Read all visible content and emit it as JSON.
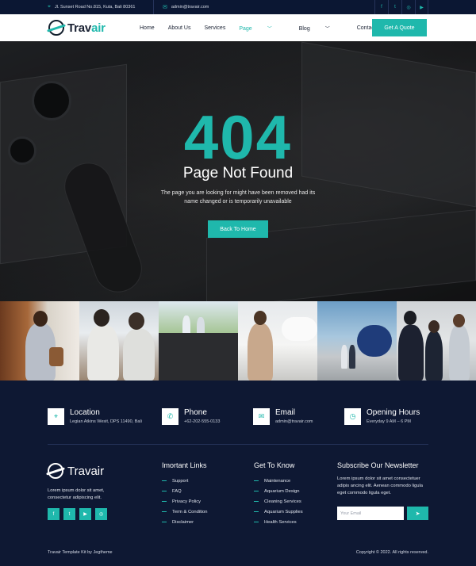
{
  "topbar": {
    "address": "Jl. Sunset Road No.815, Kuta, Bali 80361",
    "email": "admin@travair.com",
    "social_icons": [
      "facebook-icon",
      "twitter-icon",
      "instagram-icon",
      "youtube-icon"
    ],
    "social_glyphs": [
      "f",
      "t",
      "◎",
      "▶"
    ]
  },
  "brand": {
    "name_part1": "Trav",
    "name_part2": "air",
    "full": "Travair"
  },
  "nav": {
    "items": [
      {
        "label": "Home"
      },
      {
        "label": "About Us"
      },
      {
        "label": "Services"
      },
      {
        "label": "Page",
        "dropdown": true,
        "active": true
      },
      {
        "label": "Blog",
        "dropdown": true
      },
      {
        "label": "Contact Us"
      }
    ],
    "cta": "Get A Quote"
  },
  "hero": {
    "code": "404",
    "title": "Page Not Found",
    "description": "The page you are looking for might have been removed had its name changed or is temporarily unavailable",
    "button": "Back To Home"
  },
  "contacts": [
    {
      "title": "Location",
      "value": "Legian Atkins Wesit, DPS 11490, Bali",
      "icon": "location-pin-icon",
      "glyph": "⌖"
    },
    {
      "title": "Phone",
      "value": "+62-202-555-0133",
      "icon": "phone-icon",
      "glyph": "✆"
    },
    {
      "title": "Email",
      "value": "admin@travair.com",
      "icon": "email-icon",
      "glyph": "✉"
    },
    {
      "title": "Opening Hours",
      "value": "Everyday 9 AM – 6 PM",
      "icon": "clock-icon",
      "glyph": "◷"
    }
  ],
  "footer": {
    "about": "Lorem ipsum dolor sit amet, consectetur adipiscing elit.",
    "social_icons": [
      "facebook-icon",
      "twitter-icon",
      "youtube-icon",
      "instagram-icon"
    ],
    "social_glyphs": [
      "f",
      "t",
      "▶",
      "◎"
    ],
    "links_title": "Imortant Links",
    "links": [
      "Support",
      "FAQ",
      "Privacy Policy",
      "Term & Condition",
      "Disclaimer"
    ],
    "know_title": "Get To Know",
    "know": [
      "Maintenance",
      "Aquarium Design",
      "Cleaning Services",
      "Aquarium Supplies",
      "Health Services"
    ],
    "newsletter_title": "Subscribe Our Newsletter",
    "newsletter_text": "Lorem ipsum dolor sit amet consectetuer adipis ancing elit. Aenean commodo ligula eget commodo ligula eget.",
    "email_placeholder": "Your Email",
    "send_glyph": "➤",
    "credit": "Travair Template Kit by Jegtheme",
    "copyright": "Copyright © 2022. All rights reserved."
  },
  "colors": {
    "accent": "#1fb8ac",
    "navy": "#0e1833",
    "topbar": "#0b1733"
  }
}
